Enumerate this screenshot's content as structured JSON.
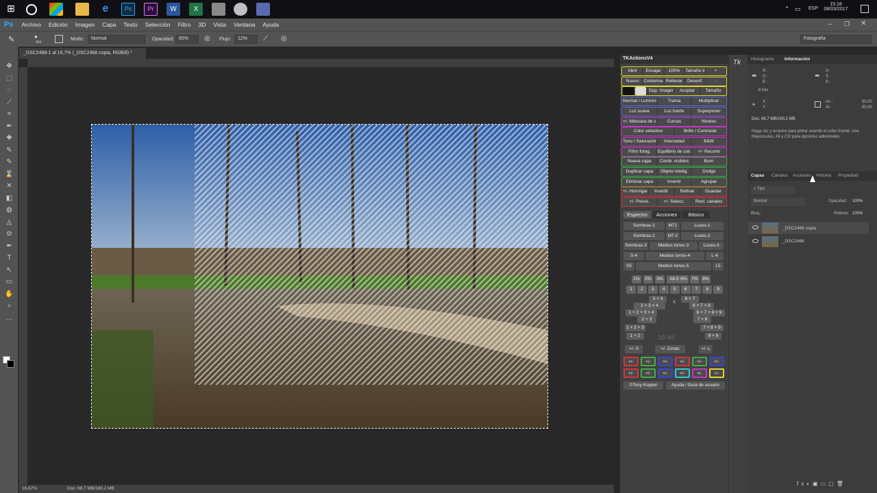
{
  "taskbar": {
    "lang": "ESP",
    "time": "15:18",
    "date": "08/03/2017"
  },
  "app": {
    "logo": "Ps"
  },
  "menu": [
    "Archivo",
    "Edición",
    "Imagen",
    "Capa",
    "Texto",
    "Selección",
    "Filtro",
    "3D",
    "Vista",
    "Ventana",
    "Ayuda"
  ],
  "options": {
    "brush_size": "464",
    "mode_label": "Modo:",
    "mode_value": "Normal",
    "opacity_label": "Opacidad:",
    "opacity_value": "65%",
    "flow_label": "Flujo:",
    "flow_value": "12%",
    "workspace": "Fotografía"
  },
  "document": {
    "tab_title": "_DSC2468-1 al 16,7% (_DSC2468 copia, RGB/8) *"
  },
  "status": {
    "zoom": "16,67%",
    "doc": "Doc: 68,7 MB/160,2 MB"
  },
  "tk": {
    "title": "TKActionsV4",
    "rows": [
      [
        "Abrir",
        "Encajar",
        "100%",
        "Tamaño Imp.",
        "+"
      ],
      [
        "Nuevo",
        "Contornear",
        "Rellenar",
        "Desenf.",
        "-"
      ],
      [
        "Dup. Imagen",
        "Acoplar",
        "Tamaño"
      ],
      [
        "Normal / Luminosidad",
        "Trama",
        "Multiplicar"
      ],
      [
        "Luz suave",
        "Luz fuerte",
        "Superponer"
      ],
      [
        "+/- Máscara de capa",
        "Curvas",
        "Niveles"
      ],
      [
        "Color selectivo",
        "Brillo / Contraste"
      ],
      [
        "Tono / Saturación",
        "Intensidad",
        "B&W"
      ],
      [
        "Filtro fotog.",
        "Equilibrio de color",
        "+/- Recorte"
      ],
      [
        "Nueva capa",
        "Comb. visibles",
        "Burn"
      ],
      [
        "Duplicar capa",
        "Objeto Intelig.",
        "Dodge"
      ],
      [
        "Eliminar capa",
        "Invertir",
        "Agrupar"
      ],
      [
        "+/- Hormigas",
        "Invertir",
        "Refinar",
        "Guardar"
      ],
      [
        "+/- Previs.",
        "+/- Selecc.",
        "Rest. canales"
      ]
    ],
    "tabs": [
      "Espectro",
      "Acciones",
      "Básico"
    ],
    "spectrum": [
      [
        "Sombras-1",
        "MT1",
        "Luces-1"
      ],
      [
        "Sombras-2",
        "MT-2",
        "Luces-2"
      ],
      [
        "Sombras-3",
        "Medios tonos-3",
        "Luces-3"
      ],
      [
        "S-4",
        "Medios tonos-4",
        "L-4"
      ],
      [
        "S5",
        "Medios tonos-5",
        "L5"
      ]
    ],
    "percents": [
      "1%",
      "2%",
      "3%",
      "Alt-5",
      "6%",
      "7%",
      "8%"
    ],
    "numbers": [
      "1",
      "2",
      "3",
      "4",
      "5",
      "6",
      "7",
      "8",
      "9"
    ],
    "combos_left": [
      "3 + 4",
      "2 + 3 + 4",
      "1 + 2 + 3 + 4",
      "2 + 3",
      "1 + 2 + 3",
      "1 + 2"
    ],
    "combos_right": [
      "6 + 7",
      "6 + 7 + 8",
      "6 + 7 + 8 + 9",
      "7 + 8",
      "7 + 8 + 9",
      "8 + 9"
    ],
    "x_label": "X",
    "watermark": "16-bit",
    "zone_row": [
      "+/- S",
      "+/- Zonas",
      "+/- L"
    ],
    "plusminus": "+/-",
    "footer": [
      "©Tony Kuyper",
      "Ayuda / Guía de usuario"
    ],
    "color_rows": [
      "#d9343a",
      "#42b045",
      "#3a44d0",
      "#d9343a",
      "#42b045",
      "#3a44d0",
      "#d9343a",
      "#42b045",
      "#3a44d0",
      "#36c9d9",
      "#cc33cc",
      "#e0d830"
    ]
  },
  "info_panel": {
    "tabs": [
      "Histograma",
      "Información"
    ],
    "rgb": [
      "R :",
      "G :",
      "B :"
    ],
    "hsb": [
      "H :",
      "S :",
      "B :"
    ],
    "bits": "8 bits",
    "xy": [
      "X :",
      "Y :"
    ],
    "wh": [
      "An :",
      "Al :"
    ],
    "wh_values": [
      "60,00",
      "60,00"
    ],
    "doc": "Doc: 68,7 MB/160,2 MB",
    "hint": "Haga clic y arrastre para pintar usando el color frontal. Use Mayúsculas, Alt y Ctrl para opciones adicionales."
  },
  "layers_panel": {
    "tabs": [
      "Capas",
      "Canales",
      "Acciones",
      "Historia",
      "Propiedad"
    ],
    "filter": "Tipo",
    "blend": "Normal",
    "opacity_label": "Opacidad:",
    "opacity": "100%",
    "lock_label": "Bloq.:",
    "fill_label": "Relleno:",
    "fill": "100%",
    "layers": [
      "_DSC2468 copia",
      "_DSC2468"
    ]
  }
}
